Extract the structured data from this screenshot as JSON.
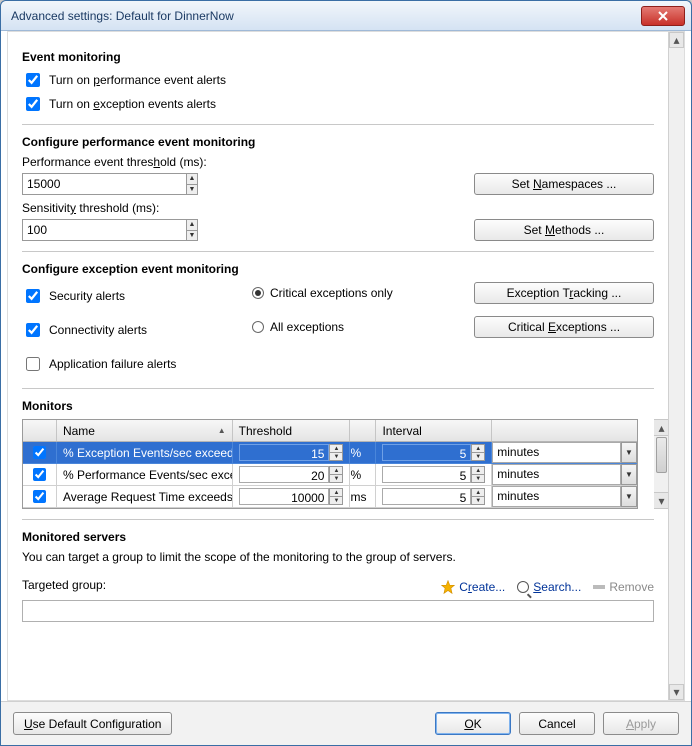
{
  "window": {
    "title": "Advanced settings: Default for DinnerNow"
  },
  "section1": {
    "heading": "Event monitoring",
    "chk_perf": "Turn on performance event alerts",
    "chk_exc": "Turn on exception events alerts"
  },
  "section2": {
    "heading": "Configure performance event monitoring",
    "perf_label": "Performance event threshold (ms):",
    "perf_value": "15000",
    "sens_label": "Sensitivity threshold (ms):",
    "sens_value": "100",
    "btn_ns": "Set Namespaces ...",
    "btn_methods": "Set Methods ..."
  },
  "section3": {
    "heading": "Configure exception event monitoring",
    "chk_sec": "Security alerts",
    "chk_conn": "Connectivity alerts",
    "chk_app": "Application failure alerts",
    "radio_crit": "Critical exceptions only",
    "radio_all": "All exceptions",
    "btn_track": "Exception Tracking ...",
    "btn_crit": "Critical Exceptions ..."
  },
  "monitors": {
    "heading": "Monitors",
    "col_name": "Name",
    "col_threshold": "Threshold",
    "col_interval": "Interval",
    "rows": [
      {
        "checked": true,
        "selected": true,
        "name": "% Exception Events/sec exceeds ...",
        "threshold": "15",
        "unit": "%",
        "interval": "5",
        "interval_unit": "minutes"
      },
      {
        "checked": true,
        "selected": false,
        "name": "% Performance Events/sec excee...",
        "threshold": "20",
        "unit": "%",
        "interval": "5",
        "interval_unit": "minutes"
      },
      {
        "checked": true,
        "selected": false,
        "name": "Average Request Time exceeds th...",
        "threshold": "10000",
        "unit": "ms",
        "interval": "5",
        "interval_unit": "minutes"
      }
    ]
  },
  "servers": {
    "heading": "Monitored servers",
    "desc": "You can target a group to limit the scope of the monitoring to the group of servers.",
    "target_label": "Targeted group:",
    "link_create": "Create...",
    "link_search": "Search...",
    "link_remove": "Remove"
  },
  "footer": {
    "use_default": "Use Default Configuration",
    "ok": "OK",
    "cancel": "Cancel",
    "apply": "Apply"
  }
}
